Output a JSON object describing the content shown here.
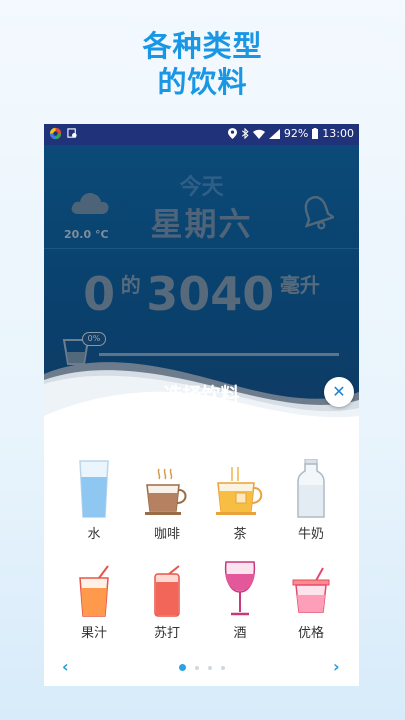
{
  "promo": {
    "line1": "各种类型",
    "line2": "的饮料"
  },
  "statusbar": {
    "battery": "92%",
    "time": "13:00"
  },
  "header": {
    "today": "今天",
    "weekday": "星期六",
    "temperature": "20.0 °C"
  },
  "intake": {
    "current": "0",
    "of": "的",
    "goal": "3040",
    "unit": "毫升",
    "percent": "0%"
  },
  "sheet": {
    "title": "选择饮料",
    "drinks": [
      {
        "label": "水",
        "icon": "water-glass-icon"
      },
      {
        "label": "咖啡",
        "icon": "coffee-cup-icon"
      },
      {
        "label": "茶",
        "icon": "tea-cup-icon"
      },
      {
        "label": "牛奶",
        "icon": "milk-bottle-icon"
      },
      {
        "label": "果汁",
        "icon": "juice-glass-icon"
      },
      {
        "label": "苏打",
        "icon": "soda-can-icon"
      },
      {
        "label": "酒",
        "icon": "wine-glass-icon"
      },
      {
        "label": "优格",
        "icon": "yogurt-cup-icon"
      }
    ],
    "page_count": 4,
    "active_page": 1
  },
  "colors": {
    "promo": "#1996e4",
    "statusbar": "#20327a",
    "accent": "#2aa3e2"
  }
}
